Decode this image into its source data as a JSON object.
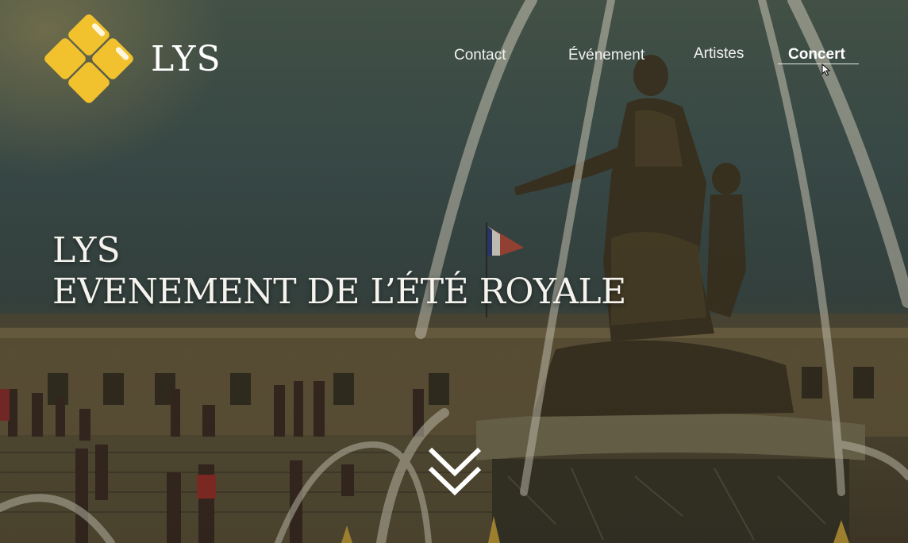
{
  "brand": {
    "name": "LYS",
    "logo_color": "#F2C12E"
  },
  "nav": {
    "items": [
      {
        "label": "Contact",
        "active": false
      },
      {
        "label": "Événement",
        "active": false
      },
      {
        "label": "Artistes",
        "active": false
      },
      {
        "label": "Concert",
        "active": true
      }
    ]
  },
  "hero": {
    "title_line1": "LYS",
    "title_line2": "EVENEMENT DE L’ÉTÉ ROYALE",
    "scroll_icon": "double-chevron-down-icon",
    "background": "fountain-statue-palace-photo"
  }
}
